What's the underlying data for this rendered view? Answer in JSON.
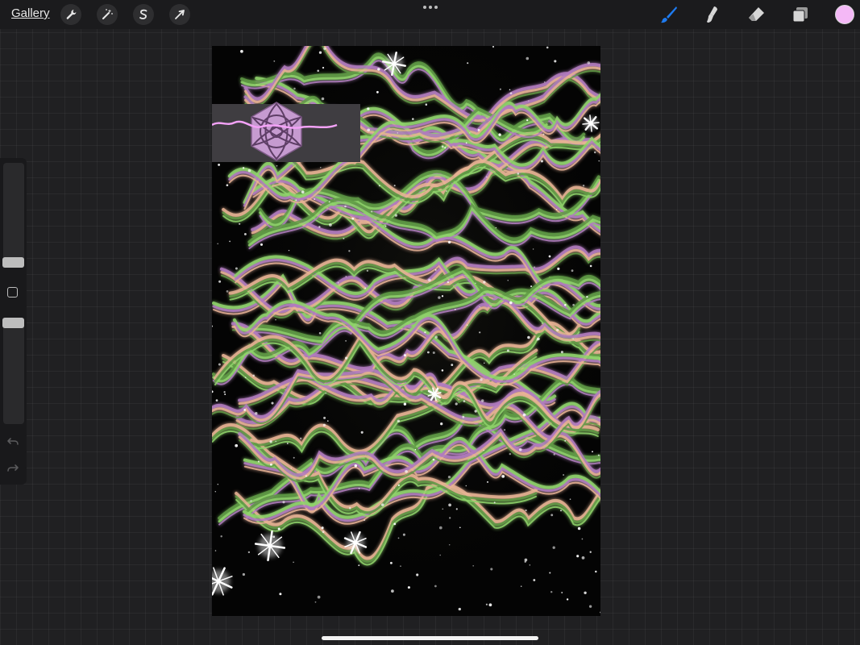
{
  "topbar": {
    "gallery_label": "Gallery",
    "left_tools": [
      "wrench-icon",
      "magic-wand-icon",
      "selection-s-icon",
      "transform-arrow-icon"
    ],
    "right_tools": [
      "brush-icon",
      "smudge-icon",
      "eraser-icon",
      "layers-icon"
    ],
    "active_tool_color": "#1e7bf0",
    "current_color": "#f4b8f6"
  },
  "sidebar": {
    "controls": [
      "brush-size-slider",
      "modify-button",
      "opacity-slider",
      "undo-icon",
      "redo-icon"
    ]
  },
  "canvas": {
    "artwork": "psychedelic-artwork",
    "overlay_colors": {
      "panel": "#3f3d41",
      "emblem": "#c69bd0",
      "stroke": "#f3a2f7"
    },
    "palette": [
      "#8fd36b",
      "#b27bbf",
      "#e8b394",
      "#5f9a45"
    ]
  }
}
